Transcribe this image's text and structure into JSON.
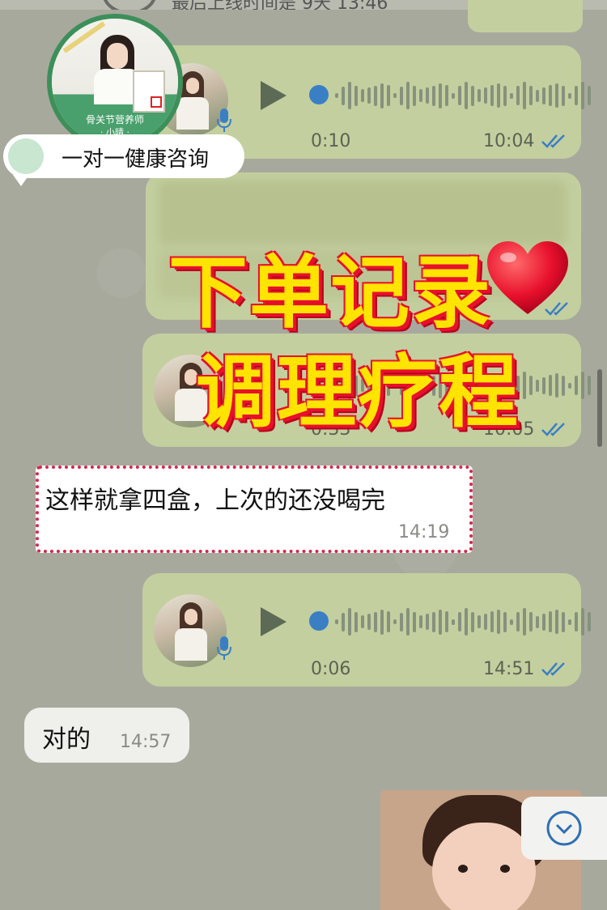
{
  "header": {
    "status_text": "最后上线时间是 9天 13:46"
  },
  "profile_badge": {
    "title": "骨关节营养师",
    "name": "· 小晴 ·",
    "consult_label": "一对一健康咨询"
  },
  "headline": {
    "line1": "下单记录",
    "line2": "调理疗程"
  },
  "messages": [
    {
      "kind": "voice",
      "direction": "outgoing",
      "duration": "0:10",
      "time": "10:04",
      "read": true
    },
    {
      "kind": "blurred",
      "direction": "outgoing",
      "time": "10:04",
      "read": true
    },
    {
      "kind": "voice",
      "direction": "outgoing",
      "duration": "0:33",
      "time": "10:05",
      "read": true
    },
    {
      "kind": "text",
      "direction": "incoming",
      "text": "这样就拿四盒，上次的还没喝完",
      "time": "14:19"
    },
    {
      "kind": "voice",
      "direction": "outgoing",
      "duration": "0:06",
      "time": "14:51",
      "read": true
    },
    {
      "kind": "text",
      "direction": "incoming",
      "text": "对的",
      "time": "14:57"
    },
    {
      "kind": "photo",
      "direction": "outgoing"
    }
  ],
  "colors": {
    "outgoing_bubble": "#c3cf9f",
    "incoming_bubble": "#efefec",
    "read_ticks": "#3a7fc4",
    "headline_fill": "#ffe400",
    "headline_stroke": "#e8102c",
    "highlight_border": "#d6264b"
  },
  "icons": {
    "play": "play-icon",
    "mic": "mic-icon",
    "ticks": "double-check-icon",
    "scroll_down": "chevron-down-circle-icon",
    "heart": "heart-icon"
  }
}
